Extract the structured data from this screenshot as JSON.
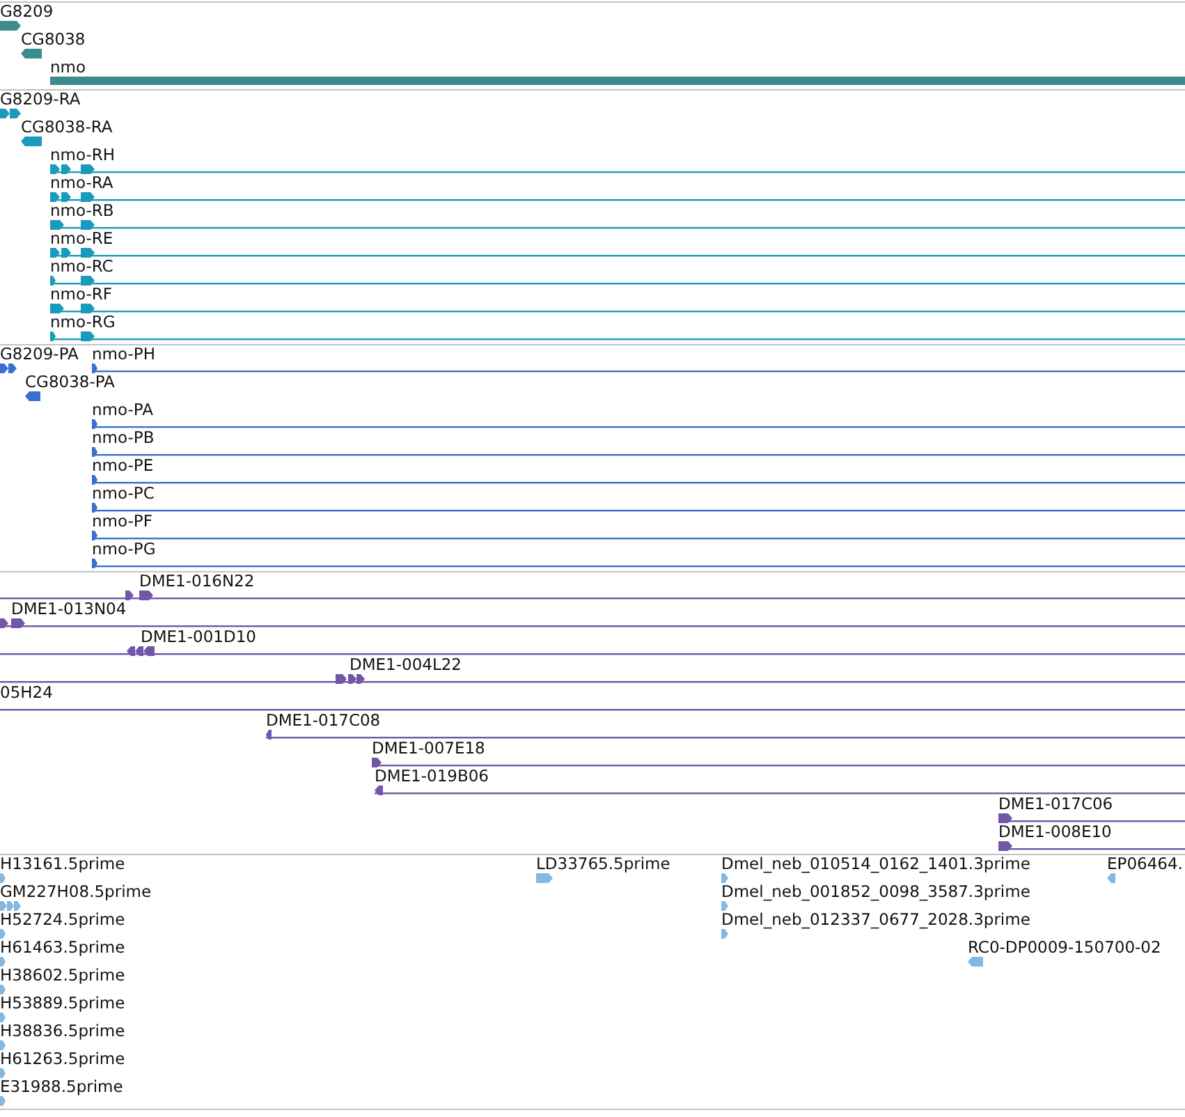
{
  "tracks": [
    {
      "color": "#3e8b8e",
      "rows": [
        [
          {
            "label": "G8209",
            "reverse": false
          }
        ],
        [
          {
            "label": "CG8038",
            "reverse": true
          }
        ],
        [
          {
            "label": "nmo"
          }
        ]
      ]
    },
    {
      "color": "#1a9bbd",
      "rows": [
        [
          {
            "label": "G8209-RA",
            "reverse": false
          }
        ],
        [
          {
            "label": "CG8038-RA",
            "reverse": true
          }
        ],
        [
          {
            "label": "nmo-RH",
            "reverse": false
          }
        ],
        [
          {
            "label": "nmo-RA",
            "reverse": false
          }
        ],
        [
          {
            "label": "nmo-RB",
            "reverse": false
          }
        ],
        [
          {
            "label": "nmo-RE",
            "reverse": false
          }
        ],
        [
          {
            "label": "nmo-RC",
            "reverse": false
          }
        ],
        [
          {
            "label": "nmo-RF",
            "reverse": false
          }
        ],
        [
          {
            "label": "nmo-RG",
            "reverse": false
          }
        ]
      ]
    },
    {
      "color": "#3a6fd0",
      "rows": [
        [
          {
            "label": "G8209-PA",
            "reverse": false
          },
          {
            "label": "nmo-PH",
            "reverse": false
          }
        ],
        [
          {
            "label": "CG8038-PA",
            "reverse": true
          }
        ],
        [
          {
            "label": "nmo-PA",
            "reverse": false
          }
        ],
        [
          {
            "label": "nmo-PB",
            "reverse": false
          }
        ],
        [
          {
            "label": "nmo-PE",
            "reverse": false
          }
        ],
        [
          {
            "label": "nmo-PC",
            "reverse": false
          }
        ],
        [
          {
            "label": "nmo-PF",
            "reverse": false
          }
        ],
        [
          {
            "label": "nmo-PG",
            "reverse": false
          }
        ]
      ]
    },
    {
      "color": "#7256a8",
      "rows": [
        [
          {
            "label": "DME1-016N22",
            "reverse": false
          }
        ],
        [
          {
            "label": "DME1-013N04",
            "reverse": false
          }
        ],
        [
          {
            "label": "DME1-001D10",
            "reverse": true
          }
        ],
        [
          {
            "label": "DME1-004L22",
            "reverse": false
          }
        ],
        [
          {
            "label": "05H24"
          }
        ],
        [
          {
            "label": "DME1-017C08",
            "reverse": true
          }
        ],
        [
          {
            "label": "DME1-007E18",
            "reverse": false
          }
        ],
        [
          {
            "label": "DME1-019B06",
            "reverse": true
          }
        ],
        [
          {
            "label": "DME1-017C06",
            "reverse": false
          }
        ],
        [
          {
            "label": "DME1-008E10",
            "reverse": false
          }
        ]
      ]
    },
    {
      "color": "#84b8e0",
      "rows": [
        [
          {
            "label": "H13161.5prime",
            "reverse": false
          },
          {
            "label": "LD33765.5prime",
            "reverse": false
          },
          {
            "label": "Dmel_neb_010514_0162_1401.3prime",
            "reverse": false
          },
          {
            "label": "EP06464.",
            "reverse": true
          }
        ],
        [
          {
            "label": "GM227H08.5prime",
            "reverse": false
          },
          {
            "label": "Dmel_neb_001852_0098_3587.3prime",
            "reverse": false
          }
        ],
        [
          {
            "label": "H52724.5prime",
            "reverse": false
          },
          {
            "label": "Dmel_neb_012337_0677_2028.3prime",
            "reverse": false
          }
        ],
        [
          {
            "label": "H61463.5prime",
            "reverse": false
          },
          {
            "label": "RC0-DP0009-150700-02",
            "reverse": true
          }
        ],
        [
          {
            "label": "H38602.5prime",
            "reverse": false
          }
        ],
        [
          {
            "label": "H53889.5prime",
            "reverse": false
          }
        ],
        [
          {
            "label": "H38836.5prime",
            "reverse": false
          }
        ],
        [
          {
            "label": "H61263.5prime",
            "reverse": false
          }
        ],
        [
          {
            "label": "E31988.5prime",
            "reverse": false
          }
        ]
      ]
    }
  ]
}
